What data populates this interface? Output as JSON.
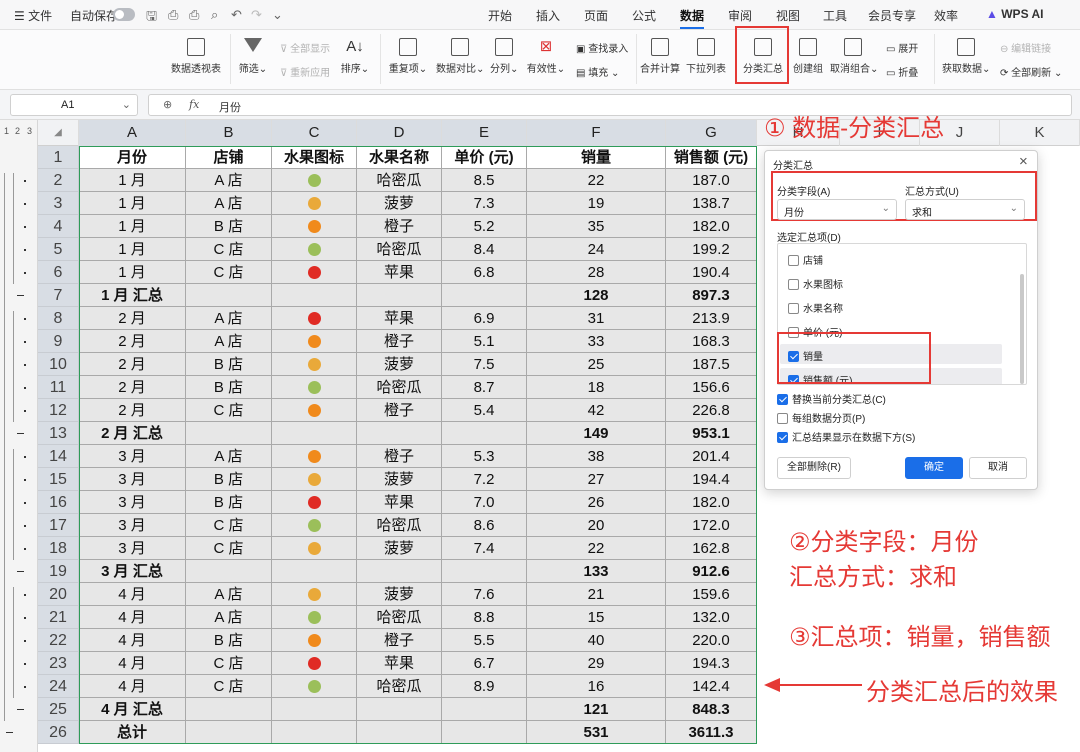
{
  "menubar": {
    "file": "文件",
    "autosave": "自动保存",
    "tabs": [
      "开始",
      "插入",
      "页面",
      "公式",
      "数据",
      "审阅",
      "视图",
      "工具",
      "会员专享",
      "效率"
    ],
    "active_tab": "数据",
    "wps_ai": "WPS AI"
  },
  "ribbon": {
    "pivot": "数据透视表",
    "filter": "筛选",
    "show_all": "全部显示",
    "reapply": "重新应用",
    "sort": "排序",
    "duplicates": "重复项",
    "compare": "数据对比",
    "split": "分列",
    "validity": "有效性",
    "find_enter": "查找录入",
    "fill": "填充",
    "consolidate": "合并计算",
    "dropdown": "下拉列表",
    "subtotal": "分类汇总",
    "create_group": "创建组",
    "ungroup": "取消组合",
    "expand": "展开",
    "collapse": "折叠",
    "get_data": "获取数据",
    "edit_links": "编辑链接",
    "refresh_all": "全部刷新"
  },
  "formula_bar": {
    "cell_ref": "A1",
    "fx": "fx",
    "content": "月份"
  },
  "outline": {
    "levels": [
      "1",
      "2",
      "3"
    ]
  },
  "columns": [
    "A",
    "B",
    "C",
    "D",
    "E",
    "F",
    "G",
    "H",
    "I",
    "J",
    "K"
  ],
  "table": {
    "headers": [
      "月份",
      "店铺",
      "水果图标",
      "水果名称",
      "单价 (元)",
      "销量",
      "销售额 (元)"
    ],
    "rows": [
      {
        "n": "2",
        "m": "1 月",
        "s": "A 店",
        "f": "melon",
        "name": "哈密瓜",
        "p": "8.5",
        "q": "22",
        "amt": "187.0"
      },
      {
        "n": "3",
        "m": "1 月",
        "s": "A 店",
        "f": "pineapple",
        "name": "菠萝",
        "p": "7.3",
        "q": "19",
        "amt": "138.7"
      },
      {
        "n": "4",
        "m": "1 月",
        "s": "B 店",
        "f": "orange",
        "name": "橙子",
        "p": "5.2",
        "q": "35",
        "amt": "182.0"
      },
      {
        "n": "5",
        "m": "1 月",
        "s": "C 店",
        "f": "melon",
        "name": "哈密瓜",
        "p": "8.4",
        "q": "24",
        "amt": "199.2"
      },
      {
        "n": "6",
        "m": "1 月",
        "s": "C 店",
        "f": "apple",
        "name": "苹果",
        "p": "6.8",
        "q": "28",
        "amt": "190.4"
      },
      {
        "n": "7",
        "m": "1 月 汇总",
        "s": "",
        "f": "",
        "name": "",
        "p": "",
        "q": "128",
        "amt": "897.3",
        "sum": true
      },
      {
        "n": "8",
        "m": "2 月",
        "s": "A 店",
        "f": "apple",
        "name": "苹果",
        "p": "6.9",
        "q": "31",
        "amt": "213.9"
      },
      {
        "n": "9",
        "m": "2 月",
        "s": "A 店",
        "f": "orange",
        "name": "橙子",
        "p": "5.1",
        "q": "33",
        "amt": "168.3"
      },
      {
        "n": "10",
        "m": "2 月",
        "s": "B 店",
        "f": "pineapple",
        "name": "菠萝",
        "p": "7.5",
        "q": "25",
        "amt": "187.5"
      },
      {
        "n": "11",
        "m": "2 月",
        "s": "B 店",
        "f": "melon",
        "name": "哈密瓜",
        "p": "8.7",
        "q": "18",
        "amt": "156.6"
      },
      {
        "n": "12",
        "m": "2 月",
        "s": "C 店",
        "f": "orange",
        "name": "橙子",
        "p": "5.4",
        "q": "42",
        "amt": "226.8"
      },
      {
        "n": "13",
        "m": "2 月 汇总",
        "s": "",
        "f": "",
        "name": "",
        "p": "",
        "q": "149",
        "amt": "953.1",
        "sum": true
      },
      {
        "n": "14",
        "m": "3 月",
        "s": "A 店",
        "f": "orange",
        "name": "橙子",
        "p": "5.3",
        "q": "38",
        "amt": "201.4"
      },
      {
        "n": "15",
        "m": "3 月",
        "s": "B 店",
        "f": "pineapple",
        "name": "菠萝",
        "p": "7.2",
        "q": "27",
        "amt": "194.4"
      },
      {
        "n": "16",
        "m": "3 月",
        "s": "B 店",
        "f": "apple",
        "name": "苹果",
        "p": "7.0",
        "q": "26",
        "amt": "182.0"
      },
      {
        "n": "17",
        "m": "3 月",
        "s": "C 店",
        "f": "melon",
        "name": "哈密瓜",
        "p": "8.6",
        "q": "20",
        "amt": "172.0"
      },
      {
        "n": "18",
        "m": "3 月",
        "s": "C 店",
        "f": "pineapple",
        "name": "菠萝",
        "p": "7.4",
        "q": "22",
        "amt": "162.8"
      },
      {
        "n": "19",
        "m": "3 月 汇总",
        "s": "",
        "f": "",
        "name": "",
        "p": "",
        "q": "133",
        "amt": "912.6",
        "sum": true
      },
      {
        "n": "20",
        "m": "4 月",
        "s": "A 店",
        "f": "pineapple",
        "name": "菠萝",
        "p": "7.6",
        "q": "21",
        "amt": "159.6"
      },
      {
        "n": "21",
        "m": "4 月",
        "s": "A 店",
        "f": "melon",
        "name": "哈密瓜",
        "p": "8.8",
        "q": "15",
        "amt": "132.0"
      },
      {
        "n": "22",
        "m": "4 月",
        "s": "B 店",
        "f": "orange",
        "name": "橙子",
        "p": "5.5",
        "q": "40",
        "amt": "220.0"
      },
      {
        "n": "23",
        "m": "4 月",
        "s": "C 店",
        "f": "apple",
        "name": "苹果",
        "p": "6.7",
        "q": "29",
        "amt": "194.3"
      },
      {
        "n": "24",
        "m": "4 月",
        "s": "C 店",
        "f": "melon",
        "name": "哈密瓜",
        "p": "8.9",
        "q": "16",
        "amt": "142.4"
      },
      {
        "n": "25",
        "m": "4 月 汇总",
        "s": "",
        "f": "",
        "name": "",
        "p": "",
        "q": "121",
        "amt": "848.3",
        "sum": true
      },
      {
        "n": "26",
        "m": "总计",
        "s": "",
        "f": "",
        "name": "",
        "p": "",
        "q": "531",
        "amt": "3611.3",
        "sum": true
      }
    ]
  },
  "fruit_colors": {
    "melon": "#9bbf5a",
    "pineapple": "#e9a93a",
    "orange": "#f08a1c",
    "apple": "#e02b24"
  },
  "annotations": {
    "a1": "① 数据-分类汇总",
    "a2_line1": "②分类字段：月份",
    "a2_line2": "汇总方式：求和",
    "a3": "③汇总项：销量，销售额",
    "a4": "分类汇总后的效果"
  },
  "dialog": {
    "title": "分类汇总",
    "close": "×",
    "field_label": "分类字段(A)",
    "field_value": "月份",
    "method_label": "汇总方式(U)",
    "method_value": "求和",
    "items_label": "选定汇总项(D)",
    "items": [
      {
        "label": "店铺",
        "checked": false
      },
      {
        "label": "水果图标",
        "checked": false
      },
      {
        "label": "水果名称",
        "checked": false
      },
      {
        "label": "单价 (元)",
        "checked": false
      },
      {
        "label": "销量",
        "checked": true
      },
      {
        "label": "销售额 (元)",
        "checked": true
      }
    ],
    "opt_replace": "替换当前分类汇总(C)",
    "opt_pagebreak": "每组数据分页(P)",
    "opt_below": "汇总结果显示在数据下方(S)",
    "btn_remove": "全部删除(R)",
    "btn_ok": "确定",
    "btn_cancel": "取消"
  }
}
